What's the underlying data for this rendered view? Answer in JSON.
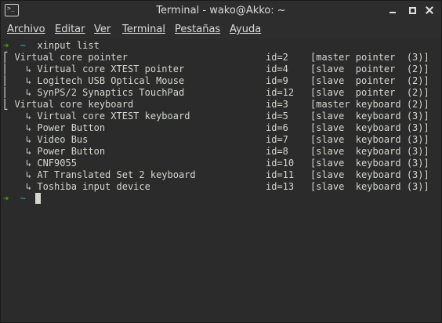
{
  "window": {
    "title": "Terminal - wako@Akko: ~",
    "icon": "terminal-icon"
  },
  "menu": {
    "items": [
      {
        "label": "Archivo"
      },
      {
        "label": "Editar"
      },
      {
        "label": "Ver"
      },
      {
        "label": "Terminal"
      },
      {
        "label": "Pestañas"
      },
      {
        "label": "Ayuda"
      }
    ]
  },
  "terminal": {
    "prompt_arrow": "➜",
    "prompt_dir": "~",
    "command": "xinput list",
    "rows": [
      {
        "name": "⎡ Virtual core pointer",
        "id": "id=2",
        "type": "[master pointer  (3)]"
      },
      {
        "name": "⎜   ↳ Virtual core XTEST pointer",
        "id": "id=4",
        "type": "[slave  pointer  (2)]"
      },
      {
        "name": "⎜   ↳ Logitech USB Optical Mouse",
        "id": "id=9",
        "type": "[slave  pointer  (2)]"
      },
      {
        "name": "⎜   ↳ SynPS/2 Synaptics TouchPad",
        "id": "id=12",
        "type": "[slave  pointer  (2)]"
      },
      {
        "name": "⎣ Virtual core keyboard",
        "id": "id=3",
        "type": "[master keyboard (2)]"
      },
      {
        "name": "    ↳ Virtual core XTEST keyboard",
        "id": "id=5",
        "type": "[slave  keyboard (3)]"
      },
      {
        "name": "    ↳ Power Button",
        "id": "id=6",
        "type": "[slave  keyboard (3)]"
      },
      {
        "name": "    ↳ Video Bus",
        "id": "id=7",
        "type": "[slave  keyboard (3)]"
      },
      {
        "name": "    ↳ Power Button",
        "id": "id=8",
        "type": "[slave  keyboard (3)]"
      },
      {
        "name": "    ↳ CNF9055",
        "id": "id=10",
        "type": "[slave  keyboard (3)]"
      },
      {
        "name": "    ↳ AT Translated Set 2 keyboard",
        "id": "id=11",
        "type": "[slave  keyboard (3)]"
      },
      {
        "name": "    ↳ Toshiba input device",
        "id": "id=13",
        "type": "[slave  keyboard (3)]"
      }
    ],
    "colors": {
      "background": "#2b2b2b",
      "foreground": "#d3d7cf",
      "prompt_arrow": "#4e9a06",
      "prompt_dir": "#3fa7a7"
    }
  }
}
